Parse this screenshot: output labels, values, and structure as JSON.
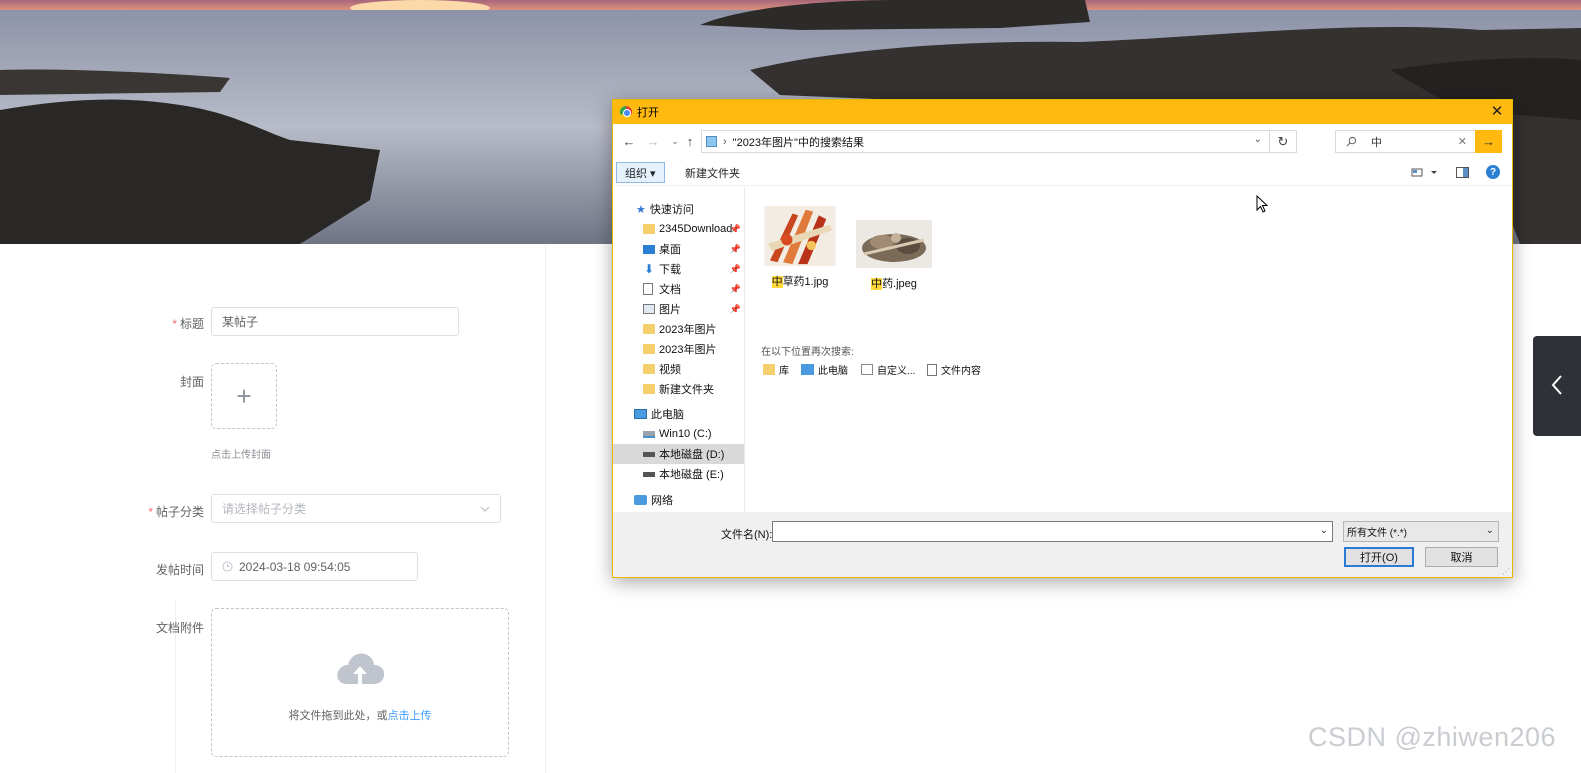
{
  "colors": {
    "accent": "#ffb90f",
    "required": "#f56c6c",
    "link": "#409eff",
    "selection": "#d9d9d9",
    "folder": "#f5cf6b"
  },
  "form": {
    "title_label": "标题",
    "title_required": "*",
    "title_value": "某帖子",
    "cover_label": "封面",
    "cover_hint": "点击上传封面",
    "category_label": "帖子分类",
    "category_required": "*",
    "category_placeholder": "请选择帖子分类",
    "time_label": "发帖时间",
    "time_value": "2024-03-18 09:54:05",
    "attach_label": "文档附件",
    "attach_text": "将文件拖到此处，或",
    "attach_link": "点击上传"
  },
  "watermark": "CSDN @zhiwen206",
  "dialog": {
    "title": "打开",
    "close_glyph": "✕",
    "address": "\"2023年图片\"中的搜索结果",
    "search_value": "中",
    "toolbar": {
      "organize": "组织 ▾",
      "new_folder": "新建文件夹"
    },
    "nav": {
      "quick_access": "快速访问",
      "items": [
        {
          "label": "2345Download",
          "pinned": "📌"
        },
        {
          "label": "桌面",
          "pinned": "📌"
        },
        {
          "label": "下载",
          "pinned": "📌"
        },
        {
          "label": "文档",
          "pinned": "📌"
        },
        {
          "label": "图片",
          "pinned": "📌"
        },
        {
          "label": "2023年图片",
          "pinned": ""
        },
        {
          "label": "2023年图片",
          "pinned": ""
        },
        {
          "label": "视频",
          "pinned": ""
        },
        {
          "label": "新建文件夹",
          "pinned": ""
        }
      ],
      "this_pc": "此电脑",
      "drives": [
        {
          "label": "Win10 (C:)"
        },
        {
          "label": "本地磁盘 (D:)"
        },
        {
          "label": "本地磁盘 (E:)"
        }
      ],
      "network": "网络"
    },
    "files": [
      {
        "hl": "中",
        "rest": "草药1.jpg"
      },
      {
        "hl": "中",
        "rest": "药.jpeg"
      }
    ],
    "research": {
      "title": "在以下位置再次搜索:",
      "items": [
        "库",
        "此电脑",
        "自定义...",
        "文件内容"
      ]
    },
    "filename_label": "文件名(N):",
    "filename_value": "",
    "filter": "所有文件 (*.*)",
    "open_button": "打开(O)",
    "cancel_button": "取消"
  }
}
